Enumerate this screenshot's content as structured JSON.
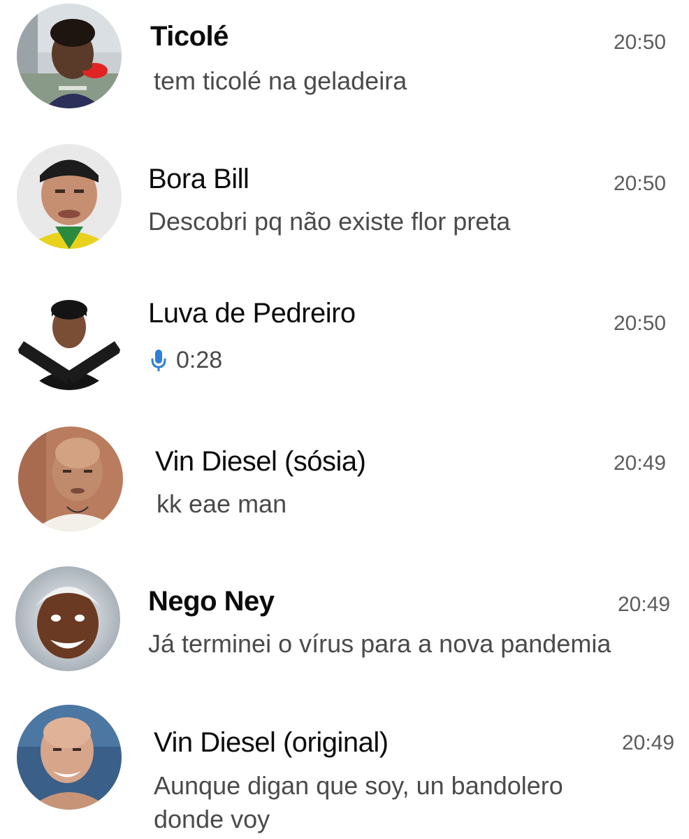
{
  "chats": [
    {
      "name": "Ticolé",
      "time": "20:50",
      "preview": "tem ticolé na geladeira",
      "avatar_icon": "avatar-boy-red-shirt"
    },
    {
      "name": "Bora Bill",
      "time": "20:50",
      "preview": "Descobri pq não existe flor preta",
      "avatar_icon": "avatar-man-cap-yellow-shirt"
    },
    {
      "name": "Luva de Pedreiro",
      "time": "20:50",
      "preview_type": "voice",
      "voice_duration": "0:28",
      "mic_color": "#2f7fd8",
      "avatar_icon": "avatar-man-crossed-arms"
    },
    {
      "name": "Vin Diesel (sósia)",
      "time": "20:49",
      "preview": "kk eae man",
      "avatar_icon": "avatar-bald-man-necklace"
    },
    {
      "name": "Nego Ney",
      "time": "20:49",
      "preview": "Já terminei o vírus para a nova pandemia",
      "avatar_icon": "avatar-smiling-kid-white-hair"
    },
    {
      "name": "Vin Diesel (original)",
      "time": "20:49",
      "preview_line1": "Aunque digan que soy, un bandolero",
      "preview_line2": "donde voy",
      "avatar_icon": "avatar-bald-man-smiling"
    }
  ]
}
